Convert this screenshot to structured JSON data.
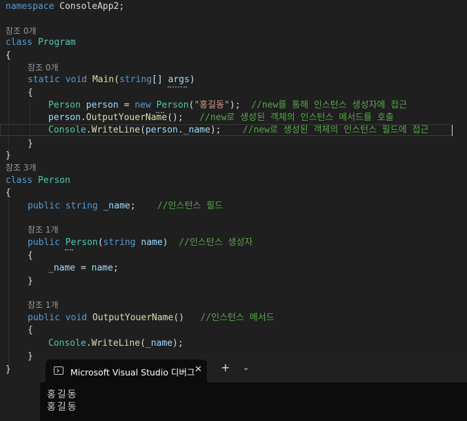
{
  "editor": {
    "ns_kw": "namespace",
    "ns_name": "ConsoleApp2",
    "ref_program": "참조 0개",
    "class_kw": "class",
    "class_program": "Program",
    "brace_open": "{",
    "brace_close": "}",
    "ref_main": "참조 0개",
    "main_static": "static",
    "main_void": "void",
    "main_name": "Main",
    "main_param_type": "string",
    "main_param_name": "args",
    "l1_type": "Person",
    "l1_var": "person",
    "l1_new": "new",
    "l1_ctor": "Person",
    "l1_str": "\"홍길동\"",
    "l1_comment": "//new를 통해 인스턴스 생성자에 접근",
    "l2_var": "person",
    "l2_method": "OutputYouerName",
    "l2_comment": "//new로 생성된 객체의 인스턴스 메서드를 호출",
    "l3_console": "Console",
    "l3_method": "WriteLine",
    "l3_var": "person",
    "l3_field": "_name",
    "l3_comment": "//new로 생성된 객체의 인스턴스 필드에 접근",
    "ref_person": "참조 3개",
    "class_person": "Person",
    "f_public": "public",
    "f_type": "string",
    "f_name": "_name",
    "f_comment": "//인스턴스 필드",
    "ref_ctor": "참조 1개",
    "c_public": "public",
    "c_name": "Person",
    "c_param_type": "string",
    "c_param_name": "name",
    "c_comment": "//인스턴스 생성자",
    "c_body_lhs": "_name",
    "c_body_rhs": "name",
    "ref_method": "참조 1개",
    "m_public": "public",
    "m_void": "void",
    "m_name": "OutputYouerName",
    "m_comment": "//인스턴스 메서드",
    "m_console": "Console",
    "m_writeline": "WriteLine",
    "m_arg": "_name"
  },
  "console": {
    "tab_title": "Microsoft Visual Studio 디버그",
    "close_glyph": "✕",
    "new_tab_glyph": "+",
    "menu_glyph": "⌄",
    "output_lines": [
      "홍길동",
      "홍길동"
    ]
  },
  "colors": {
    "editor_bg": "#1f1f1f",
    "keyword": "#569cd6",
    "type": "#4ec9b0",
    "method": "#dcdcaa",
    "variable": "#9cdcfe",
    "string": "#d69d85",
    "comment": "#57a64a",
    "console_bg": "#0c0c0c"
  }
}
